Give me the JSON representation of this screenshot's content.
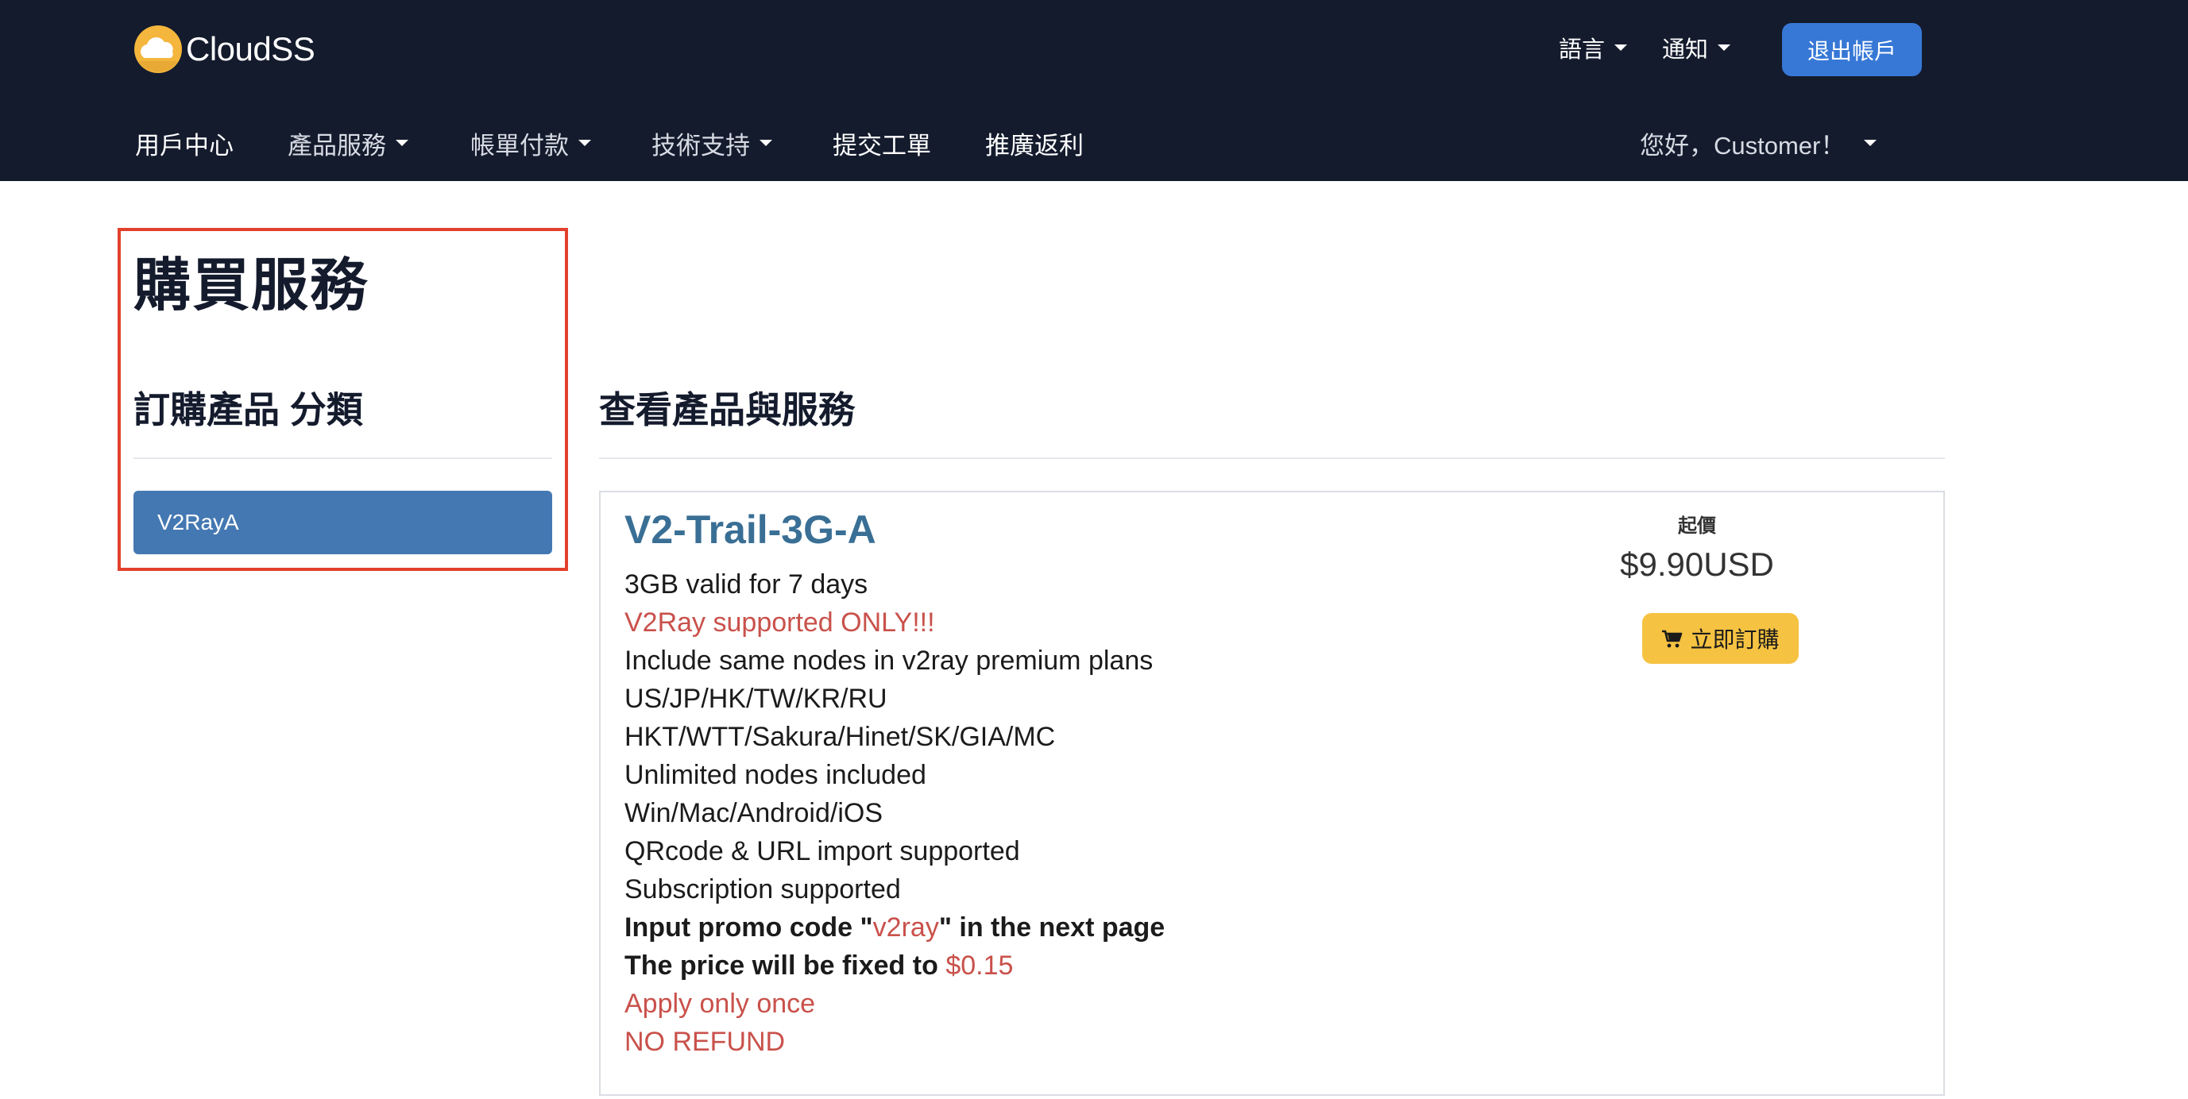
{
  "header": {
    "brand": "CloudSS",
    "language_label": "語言",
    "notify_label": "通知",
    "logout_label": "退出帳戶"
  },
  "nav": {
    "items": [
      {
        "label": "用戶中心"
      },
      {
        "label": "產品服務"
      },
      {
        "label": "帳單付款"
      },
      {
        "label": "技術支持"
      },
      {
        "label": "提交工單"
      },
      {
        "label": "推廣返利"
      }
    ],
    "greeting": "您好，Customer！"
  },
  "page": {
    "title": "購買服務",
    "sidebar_title": "訂購產品 分類",
    "category": "V2RayA",
    "main_title": "查看產品與服務"
  },
  "product": {
    "name": "V2-Trail-3G-A",
    "lines": {
      "l1": "3GB valid for 7 days",
      "l2": "V2Ray supported ONLY!!!",
      "l3": "Include same nodes in v2ray premium plans",
      "l4": "US/JP/HK/TW/KR/RU",
      "l5": "HKT/WTT/Sakura/Hinet/SK/GIA/MC",
      "l6": "Unlimited nodes included",
      "l7": "Win/Mac/Android/iOS",
      "l8": "QRcode & URL import supported",
      "l9": "Subscription supported",
      "promo_prefix": "Input promo code \"",
      "promo_code": "v2ray",
      "promo_suffix": "\" in the next page",
      "fixed_prefix": "The price will be fixed to ",
      "fixed_price": "$0.15",
      "apply_once": "Apply only once",
      "no_refund": "NO REFUND"
    },
    "price_label": "起價",
    "price": "$9.90USD",
    "order_label": "立即訂購"
  },
  "colors": {
    "topbar": "#141b2d",
    "accent_blue": "#3778d6",
    "category_blue": "#4478b2",
    "product_title": "#3a6f95",
    "warning_red": "#c9514b",
    "order_yellow": "#f6c242",
    "highlight_border": "#e2402c"
  }
}
